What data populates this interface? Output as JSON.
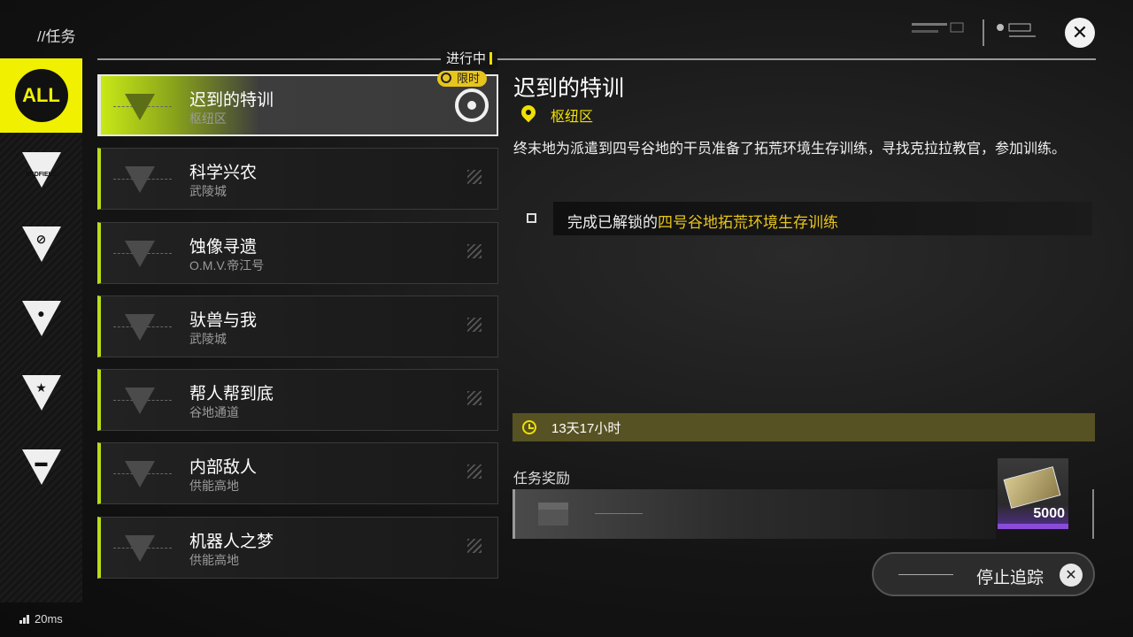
{
  "header": {
    "breadcrumb": "//任务",
    "status_tag": "进行中",
    "close_icon": "close-icon"
  },
  "sidebar": {
    "items": [
      {
        "id": "all",
        "label": "ALL",
        "active": true
      },
      {
        "id": "endfield",
        "label": "ENDFIELD",
        "icon": "endfield-triangle-icon"
      },
      {
        "id": "cat2",
        "label": "",
        "icon": "slash-triangle-icon"
      },
      {
        "id": "cat3",
        "label": "",
        "icon": "person-triangle-icon"
      },
      {
        "id": "cat4",
        "label": "",
        "icon": "star-triangle-icon"
      },
      {
        "id": "cat5",
        "label": "",
        "icon": "battery-triangle-icon"
      }
    ]
  },
  "quests": [
    {
      "title": "迟到的特训",
      "area": "枢纽区",
      "active": true,
      "limited_label": "限时",
      "tracked": true
    },
    {
      "title": "科学兴农",
      "area": "武陵城"
    },
    {
      "title": "蚀像寻遗",
      "area": "O.M.V.帝江号"
    },
    {
      "title": "驮兽与我",
      "area": "武陵城"
    },
    {
      "title": "帮人帮到底",
      "area": "谷地通道"
    },
    {
      "title": "内部敌人",
      "area": "供能高地"
    },
    {
      "title": "机器人之梦",
      "area": "供能高地"
    }
  ],
  "detail": {
    "title": "迟到的特训",
    "location": "枢纽区",
    "description": "终末地为派遣到四号谷地的干员准备了拓荒环境生存训练，寻找克拉拉教官，参加训练。",
    "objective_prefix": "完成已解锁的",
    "objective_highlight": "四号谷地拓荒环境生存训练",
    "time_remaining": "13天17小时",
    "reward_label": "任务奖励",
    "reward_count": "5000",
    "stop_tracking_label": "停止追踪"
  },
  "status_bar": {
    "ping": "20ms"
  },
  "colors": {
    "accent_yellow": "#f0f000",
    "accent_green": "#b7dd1c",
    "highlight_gold": "#e8c51c",
    "rare_purple": "#8a4cd8"
  }
}
